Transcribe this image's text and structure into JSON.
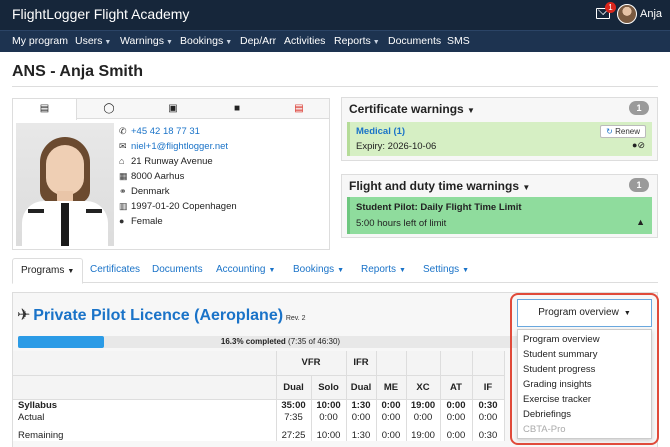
{
  "topbar": {
    "brand": "FlightLogger Flight Academy",
    "notification_count": "1",
    "user": "Anja",
    "bg_color": "#16263a"
  },
  "nav": [
    {
      "label": "My program"
    },
    {
      "label": "Users",
      "caret": "▼"
    },
    {
      "label": "Warnings",
      "caret": "▼"
    },
    {
      "label": "Bookings",
      "caret": "▼"
    },
    {
      "label": "Dep/Arr"
    },
    {
      "label": "Activities"
    },
    {
      "label": "Reports",
      "caret": "▼"
    },
    {
      "label": "Documents"
    },
    {
      "label": "SMS"
    }
  ],
  "page": {
    "title": "ANS - Anja Smith"
  },
  "profile": {
    "phone": "+45 42 18 77 31",
    "email": "niel+1@flightlogger.net",
    "street": "21 Runway Avenue",
    "city": "8000 Aarhus",
    "country": "Denmark",
    "birth": "1997-01-20 Copenhagen",
    "gender": "Female"
  },
  "certificate_warnings": {
    "title": "Certificate warnings",
    "count": "1",
    "item_title": "Medical (1)",
    "expiry": "Expiry: 2026-10-06",
    "renew_label": "Renew"
  },
  "duty_warnings": {
    "title": "Flight and duty time warnings",
    "count": "1",
    "item_title": "Student Pilot: Daily Flight Time Limit",
    "detail": "5:00 hours left of limit"
  },
  "section_tabs": [
    {
      "label": "Programs",
      "caret": "▼"
    },
    {
      "label": "Certificates"
    },
    {
      "label": "Documents"
    },
    {
      "label": "Accounting",
      "caret": "▼"
    },
    {
      "label": "Bookings",
      "caret": "▼"
    },
    {
      "label": "Reports",
      "caret": "▼"
    },
    {
      "label": "Settings",
      "caret": "▼"
    }
  ],
  "program": {
    "name": "Private Pilot Licence (Aeroplane)",
    "rev": "Rev. 2",
    "progress_fraction": 0.163,
    "progress_pct": "16.3% completed",
    "progress_detail": "(7:35 of 46:30)"
  },
  "syllabus_table": {
    "groups": [
      "VFR",
      "IFR"
    ],
    "columns": [
      "Dual",
      "Solo",
      "Dual",
      "ME",
      "XC",
      "AT",
      "IF"
    ],
    "rows": [
      {
        "label": "Syllabus",
        "values": [
          "35:00",
          "10:00",
          "1:30",
          "0:00",
          "19:00",
          "0:00",
          "0:30"
        ],
        "bold": true
      },
      {
        "label": "Actual",
        "values": [
          "7:35",
          "0:00",
          "0:00",
          "0:00",
          "0:00",
          "0:00",
          "0:00"
        ]
      },
      {
        "label": "Remaining",
        "values": [
          "27:25",
          "10:00",
          "1:30",
          "0:00",
          "19:00",
          "0:00",
          "0:30"
        ]
      }
    ]
  },
  "dropdown": {
    "button_label": "Program overview",
    "items": [
      "Program overview",
      "Student summary",
      "Student progress",
      "Grading insights",
      "Exercise tracker",
      "Debriefings",
      "CBTA-Pro"
    ]
  },
  "colors": {
    "accent": "#1a73c8",
    "highlight": "#e04a3a",
    "warning_bg": "#d6efc4",
    "duty_bg": "#8fdc9d"
  }
}
